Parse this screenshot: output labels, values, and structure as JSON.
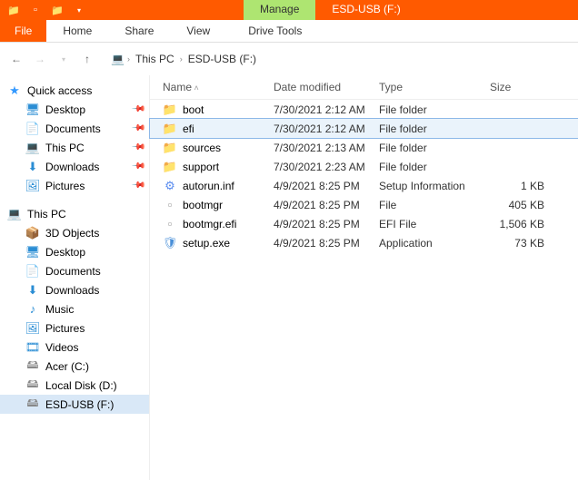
{
  "titlebar": {
    "contextual_label": "Manage",
    "window_title": "ESD-USB (F:)"
  },
  "ribbon": {
    "file": "File",
    "tabs": [
      "Home",
      "Share",
      "View",
      "Drive Tools"
    ]
  },
  "breadcrumb": {
    "segments": [
      "This PC",
      "ESD-USB (F:)"
    ]
  },
  "sidebar": {
    "quick_access": {
      "label": "Quick access",
      "items": [
        {
          "icon": "desktop",
          "label": "Desktop",
          "pinned": true
        },
        {
          "icon": "docs",
          "label": "Documents",
          "pinned": true
        },
        {
          "icon": "thispc",
          "label": "This PC",
          "pinned": true
        },
        {
          "icon": "dl",
          "label": "Downloads",
          "pinned": true
        },
        {
          "icon": "pic",
          "label": "Pictures",
          "pinned": true
        }
      ]
    },
    "this_pc": {
      "label": "This PC",
      "items": [
        {
          "icon": "obj3d",
          "label": "3D Objects"
        },
        {
          "icon": "desktop",
          "label": "Desktop"
        },
        {
          "icon": "docs",
          "label": "Documents"
        },
        {
          "icon": "dl",
          "label": "Downloads"
        },
        {
          "icon": "music",
          "label": "Music"
        },
        {
          "icon": "pic",
          "label": "Pictures"
        },
        {
          "icon": "video",
          "label": "Videos"
        },
        {
          "icon": "drive",
          "label": "Acer (C:)"
        },
        {
          "icon": "drive",
          "label": "Local Disk (D:)"
        },
        {
          "icon": "usb",
          "label": "ESD-USB (F:)",
          "selected": true
        }
      ]
    }
  },
  "columns": {
    "name": "Name",
    "date": "Date modified",
    "type": "Type",
    "size": "Size"
  },
  "files": [
    {
      "icon": "folder",
      "name": "boot",
      "date": "7/30/2021 2:12 AM",
      "type": "File folder",
      "size": ""
    },
    {
      "icon": "folder",
      "name": "efi",
      "date": "7/30/2021 2:12 AM",
      "type": "File folder",
      "size": "",
      "selected": true
    },
    {
      "icon": "folder",
      "name": "sources",
      "date": "7/30/2021 2:13 AM",
      "type": "File folder",
      "size": ""
    },
    {
      "icon": "folder",
      "name": "support",
      "date": "7/30/2021 2:23 AM",
      "type": "File folder",
      "size": ""
    },
    {
      "icon": "gear",
      "name": "autorun.inf",
      "date": "4/9/2021 8:25 PM",
      "type": "Setup Information",
      "size": "1 KB"
    },
    {
      "icon": "file",
      "name": "bootmgr",
      "date": "4/9/2021 8:25 PM",
      "type": "File",
      "size": "405 KB"
    },
    {
      "icon": "file",
      "name": "bootmgr.efi",
      "date": "4/9/2021 8:25 PM",
      "type": "EFI File",
      "size": "1,506 KB"
    },
    {
      "icon": "shield",
      "name": "setup.exe",
      "date": "4/9/2021 8:25 PM",
      "type": "Application",
      "size": "73 KB"
    }
  ],
  "icons": {
    "star": "★",
    "desktop": "🖥",
    "docs": "📄",
    "thispc": "💻",
    "dl": "⬇",
    "pic": "🖼",
    "music": "♪",
    "video": "🎞",
    "drive": "🖴",
    "usb": "🖴",
    "obj3d": "📦",
    "folder": "📁",
    "file": "▫",
    "gear": "⚙",
    "shield": "🛡"
  }
}
